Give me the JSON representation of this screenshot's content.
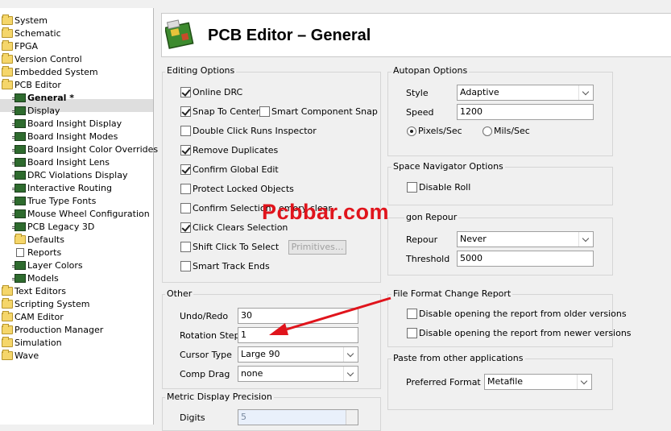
{
  "tree": {
    "items": [
      {
        "label": "System",
        "icon": "folder-icon"
      },
      {
        "label": "Schematic",
        "icon": "folder-icon"
      },
      {
        "label": "FPGA",
        "icon": "folder-icon"
      },
      {
        "label": "Version Control",
        "icon": "folder-icon"
      },
      {
        "label": "Embedded System",
        "icon": "folder-icon"
      },
      {
        "label": "PCB Editor",
        "icon": "folder-open-icon"
      },
      {
        "label": "General *",
        "icon": "chip-icon",
        "selected": true
      },
      {
        "label": "Display",
        "icon": "chip-icon"
      },
      {
        "label": "Board Insight Display",
        "icon": "chip-icon"
      },
      {
        "label": "Board Insight Modes",
        "icon": "chip-icon"
      },
      {
        "label": "Board Insight Color Overrides",
        "icon": "chip-icon"
      },
      {
        "label": "Board Insight Lens",
        "icon": "chip-icon"
      },
      {
        "label": "DRC Violations Display",
        "icon": "chip-icon"
      },
      {
        "label": "Interactive Routing",
        "icon": "chip-icon"
      },
      {
        "label": "True Type Fonts",
        "icon": "chip-icon"
      },
      {
        "label": "Mouse Wheel Configuration",
        "icon": "chip-icon"
      },
      {
        "label": "PCB Legacy 3D",
        "icon": "pcb-3d-icon"
      },
      {
        "label": "Defaults",
        "icon": "folder-icon"
      },
      {
        "label": "Reports",
        "icon": "document-icon"
      },
      {
        "label": "Layer Colors",
        "icon": "chip-icon"
      },
      {
        "label": "Models",
        "icon": "chip-icon"
      },
      {
        "label": "Text Editors",
        "icon": "folder-icon"
      },
      {
        "label": "Scripting System",
        "icon": "folder-icon"
      },
      {
        "label": "CAM Editor",
        "icon": "folder-icon"
      },
      {
        "label": "Production Manager",
        "icon": "folder-icon"
      },
      {
        "label": "Simulation",
        "icon": "folder-icon"
      },
      {
        "label": "Wave",
        "icon": "folder-icon"
      }
    ]
  },
  "header": {
    "title": "PCB Editor – General"
  },
  "editing": {
    "title": "Editing Options",
    "online_drc": "Online DRC",
    "snap_to_center": "Snap To Center",
    "smart_component_snap": "Smart Component Snap",
    "double_click": "Double Click Runs Inspector",
    "remove_duplicates": "Remove Duplicates",
    "confirm_global": "Confirm Global Edit",
    "protect_locked": "Protect Locked Objects",
    "confirm_selection": "Confirm Selection",
    "memory_clear": "emory clear",
    "click_clears": "Click Clears Selection",
    "shift_click": "Shift Click To Select",
    "primitives": "Primitives...",
    "smart_track": "Smart Track Ends"
  },
  "other": {
    "title": "Other",
    "undo_label": "Undo/Redo",
    "undo_value": "30",
    "rotation_label": "Rotation Step",
    "rotation_value": "1",
    "cursor_label": "Cursor Type",
    "cursor_value": "Large 90",
    "comp_drag_label": "Comp Drag",
    "comp_drag_value": "none"
  },
  "metric": {
    "title": "Metric Display Precision",
    "digits_label": "Digits",
    "digits_value": "5"
  },
  "autopan": {
    "title": "Autopan Options",
    "style_label": "Style",
    "style_value": "Adaptive",
    "speed_label": "Speed",
    "speed_value": "1200",
    "pixels": "Pixels/Sec",
    "mils": "Mils/Sec"
  },
  "space_nav": {
    "title": "Space Navigator Options",
    "disable_roll": "Disable Roll"
  },
  "polygon": {
    "title_visible": "gon Repour",
    "repour_label": "Repour",
    "repour_value": "Never",
    "threshold_label": "Threshold",
    "threshold_value": "5000"
  },
  "file_format": {
    "title": "File Format Change Report",
    "older": "Disable opening the report from older versions",
    "newer": "Disable opening the report from newer versions"
  },
  "paste": {
    "title": "Paste from other applications",
    "format_label": "Preferred Format",
    "format_value": "Metafile"
  },
  "watermark": {
    "text": "Pcbbar.com"
  },
  "colors": {
    "annotation_arrow": "#e0141c",
    "watermark": "#e0141c"
  }
}
